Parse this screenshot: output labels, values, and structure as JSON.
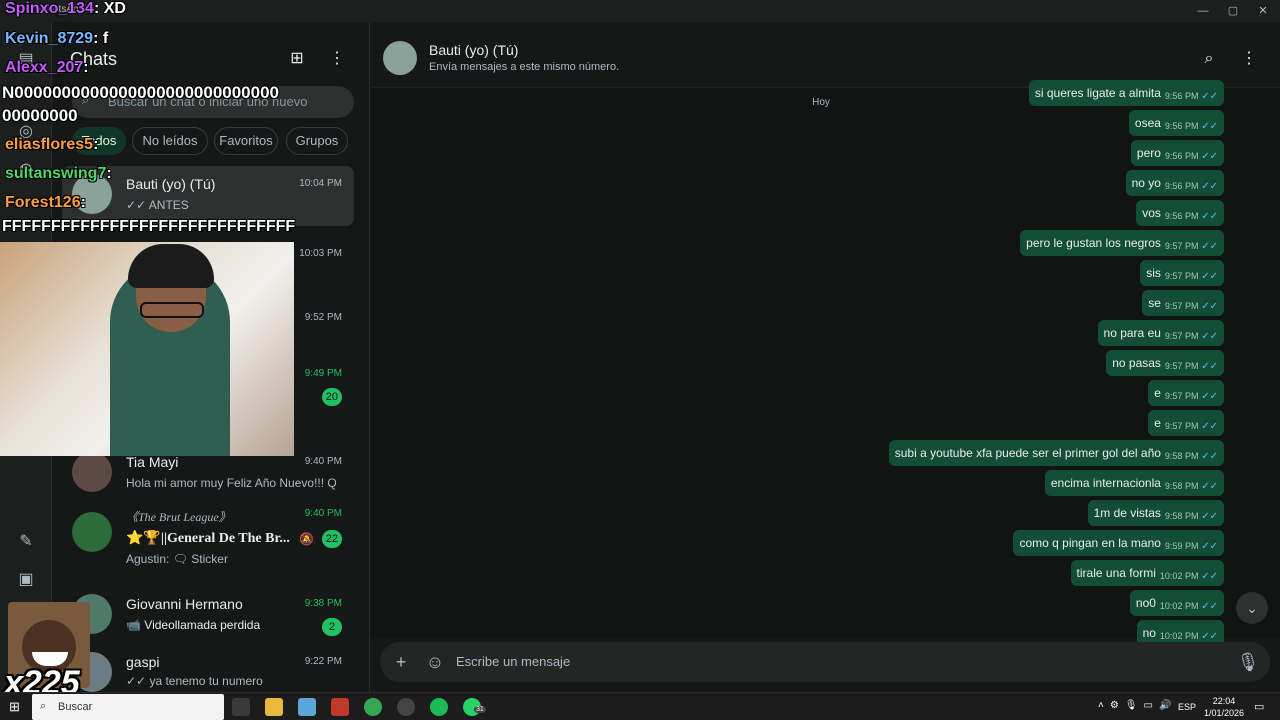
{
  "window": {
    "app_title": "WhatsApp",
    "min_icon": "minimize-icon",
    "max_icon": "maximize-icon",
    "close_icon": "close-icon"
  },
  "sidebar": {
    "title": "Chats",
    "new_chat_icon": "new-chat-icon",
    "menu_icon": "kebab-menu-icon"
  },
  "search": {
    "placeholder": "Buscar un chat o iniciar uno nuevo"
  },
  "filters": [
    "Todos",
    "No leídos",
    "Favoritos",
    "Grupos"
  ],
  "chats": [
    {
      "name": "Bauti (yo) (Tú)",
      "preview": "✓✓ ANTES",
      "time": "10:04 PM",
      "unread": "",
      "active": true
    },
    {
      "name": "",
      "preview": "",
      "time": "10:03 PM",
      "unread": ""
    },
    {
      "name": "",
      "preview": "",
      "time": "9:52 PM",
      "unread": ""
    },
    {
      "name": "",
      "preview": "",
      "time": "9:49 PM",
      "unread": "20"
    },
    {
      "name": "Tia Mayi",
      "preview": "Hola mi amor muy Feliz Año Nuevo!!! Q...",
      "time": "9:40 PM",
      "unread": ""
    },
    {
      "name": "⭐🏆||General De The Br...",
      "preview": "Agustin: 🗨 Sticker",
      "time": "9:40 PM",
      "unread": "22",
      "group_tag": "《The Brut League》"
    },
    {
      "name": "Giovanni Hermano",
      "preview": "📹 Videollamada perdida",
      "time": "9:38 PM",
      "unread": "2"
    },
    {
      "name": "gaspi",
      "preview": "✓✓ ya tenemo tu numero",
      "time": "9:22 PM",
      "unread": ""
    }
  ],
  "stream_chat": [
    {
      "name": "Spinxo_134",
      "text": ": XD",
      "color": "#c45bff"
    },
    {
      "name": "Kevin_8729",
      "text": ": f",
      "color": "#7ab7ff"
    },
    {
      "name": "Alexx_207",
      "text": ":",
      "color": "#c45bff"
    },
    {
      "name": "",
      "text": "N0000000000000000000000000000",
      "color": "#ffffff"
    },
    {
      "name": "",
      "text": "00000000",
      "color": "#ffffff"
    },
    {
      "name": "eliasflores5",
      "text": ":",
      "color": "#ff9f43"
    },
    {
      "name": "sultanswing7",
      "text": ":",
      "color": "#4cd964"
    },
    {
      "name": "Forest126",
      "text": ":",
      "color": "#ff9f43"
    },
    {
      "name": "",
      "text": "FFFFFFFFFFFFFFFFFFFFFFFFFFFFFF",
      "color": "#ffffff"
    }
  ],
  "sticker_counter": "x225",
  "conversation": {
    "name": "Bauti (yo) (Tú)",
    "subtitle": "Envía mensajes a este mismo número.",
    "day_label": "Hoy",
    "messages": [
      {
        "text": "si queres ligate a almita",
        "time": "9:56 PM"
      },
      {
        "text": "osea",
        "time": "9:56 PM"
      },
      {
        "text": "pero",
        "time": "9:56 PM"
      },
      {
        "text": "no yo",
        "time": "9:56 PM"
      },
      {
        "text": "vos",
        "time": "9:56 PM"
      },
      {
        "text": "pero le gustan los negros",
        "time": "9:57 PM"
      },
      {
        "text": "sis",
        "time": "9:57 PM"
      },
      {
        "text": "se",
        "time": "9:57 PM"
      },
      {
        "text": "no para eu",
        "time": "9:57 PM"
      },
      {
        "text": "no pasas",
        "time": "9:57 PM"
      },
      {
        "text": "e",
        "time": "9:57 PM"
      },
      {
        "text": "e",
        "time": "9:57 PM"
      },
      {
        "text": "subi a youtube xfa puede ser el primer gol del año",
        "time": "9:58 PM"
      },
      {
        "text": "encima internacionla",
        "time": "9:58 PM"
      },
      {
        "text": "1m de vistas",
        "time": "9:58 PM"
      },
      {
        "text": "como q pingan en la mano",
        "time": "9:59 PM"
      },
      {
        "text": "tirale una formi",
        "time": "10:02 PM"
      },
      {
        "text": "no0",
        "time": "10:02 PM"
      },
      {
        "text": "no",
        "time": "10:02 PM"
      }
    ]
  },
  "composer": {
    "placeholder": "Escribe un mensaje"
  },
  "taskbar": {
    "search_label": "Buscar",
    "lang": "ESP",
    "time": "22:04",
    "date": "1/01/2026",
    "whatsapp_badge": "31"
  }
}
